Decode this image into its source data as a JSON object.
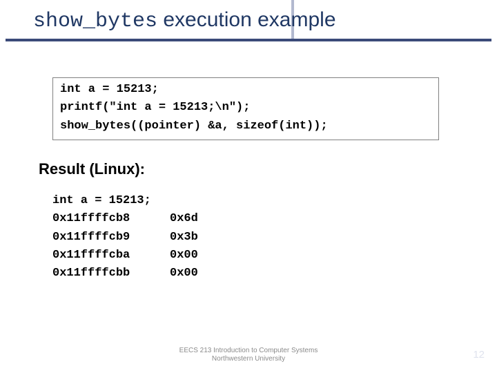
{
  "title": {
    "prefix": "show_bytes",
    "suffix": " execution example"
  },
  "code": {
    "line1": "int a = 15213;",
    "line2": "printf(\"int a = 15213;\\n\");",
    "line3": "show_bytes((pointer) &a, sizeof(int));"
  },
  "result_label": "Result (Linux):",
  "output": {
    "header": "int a = 15213;",
    "rows": [
      {
        "addr": "0x11ffffcb8",
        "val": "0x6d"
      },
      {
        "addr": "0x11ffffcb9",
        "val": "0x3b"
      },
      {
        "addr": "0x11ffffcba",
        "val": "0x00"
      },
      {
        "addr": "0x11ffffcbb",
        "val": "0x00"
      }
    ]
  },
  "footer": {
    "line1": "EECS 213 Introduction to Computer Systems",
    "line2": "Northwestern University"
  },
  "page_number": "12"
}
